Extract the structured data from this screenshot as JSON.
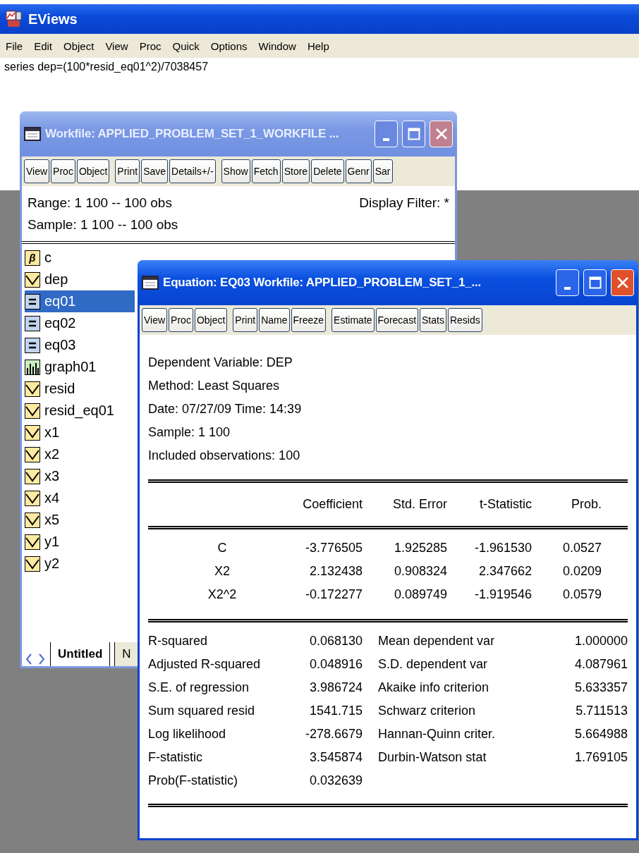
{
  "app": {
    "title": "EViews",
    "menu": [
      "File",
      "Edit",
      "Object",
      "View",
      "Proc",
      "Quick",
      "Options",
      "Window",
      "Help"
    ],
    "command": "series dep=(100*resid_eq01^2)/7038457"
  },
  "workfile": {
    "title": "Workfile: APPLIED_PROBLEM_SET_1_WORKFILE ...",
    "active": false,
    "toolbar": [
      [
        "View",
        "Proc",
        "Object"
      ],
      [
        "Print",
        "Save",
        "Details+/-"
      ],
      [
        "Show",
        "Fetch",
        "Store",
        "Delete",
        "Genr",
        "Sar"
      ]
    ],
    "range": "Range:  1 100  --  100 obs",
    "sample": "Sample: 1 100  --  100 obs",
    "filter": "Display Filter: *",
    "objects": [
      {
        "name": "c",
        "kind": "coef",
        "glyph": "β",
        "selected": false
      },
      {
        "name": "dep",
        "kind": "series",
        "selected": false
      },
      {
        "name": "eq01",
        "kind": "equation",
        "selected": true
      },
      {
        "name": "eq02",
        "kind": "equation",
        "selected": false
      },
      {
        "name": "eq03",
        "kind": "equation",
        "selected": false
      },
      {
        "name": "graph01",
        "kind": "graph",
        "selected": false
      },
      {
        "name": "resid",
        "kind": "series",
        "selected": false
      },
      {
        "name": "resid_eq01",
        "kind": "series",
        "selected": false
      },
      {
        "name": "x1",
        "kind": "series",
        "selected": false
      },
      {
        "name": "x2",
        "kind": "series",
        "selected": false
      },
      {
        "name": "x3",
        "kind": "series",
        "selected": false
      },
      {
        "name": "x4",
        "kind": "series",
        "selected": false
      },
      {
        "name": "x5",
        "kind": "series",
        "selected": false
      },
      {
        "name": "y1",
        "kind": "series",
        "selected": false
      },
      {
        "name": "y2",
        "kind": "series",
        "selected": false
      }
    ],
    "tabs": [
      {
        "label": "Untitled",
        "selected": true
      },
      {
        "label": "N",
        "selected": false
      }
    ]
  },
  "equation": {
    "title": "Equation: EQ03   Workfile: APPLIED_PROBLEM_SET_1_...",
    "active": true,
    "toolbar": [
      [
        "View",
        "Proc",
        "Object"
      ],
      [
        "Print",
        "Name",
        "Freeze"
      ],
      [
        "Estimate",
        "Forecast",
        "Stats",
        "Resids"
      ]
    ],
    "header": [
      "Dependent Variable: DEP",
      "Method: Least Squares",
      "Date: 07/27/09   Time: 14:39",
      "Sample: 1 100",
      "Included observations: 100"
    ],
    "columns": [
      "",
      "Coefficient",
      "Std. Error",
      "t-Statistic",
      "Prob."
    ],
    "rows": [
      [
        "C",
        "-3.776505",
        "1.925285",
        "-1.961530",
        "0.0527"
      ],
      [
        "X2",
        "2.132438",
        "0.908324",
        "2.347662",
        "0.0209"
      ],
      [
        "X2^2",
        "-0.172277",
        "0.089749",
        "-1.919546",
        "0.0579"
      ]
    ],
    "stats": [
      [
        "R-squared",
        "0.068130",
        "Mean dependent var",
        "1.000000"
      ],
      [
        "Adjusted R-squared",
        "0.048916",
        "S.D. dependent var",
        "4.087961"
      ],
      [
        "S.E. of regression",
        "3.986724",
        "Akaike info criterion",
        "5.633357"
      ],
      [
        "Sum squared resid",
        "1541.715",
        "Schwarz criterion",
        "5.711513"
      ],
      [
        "Log likelihood",
        "-278.6679",
        "Hannan-Quinn criter.",
        "5.664988"
      ],
      [
        "F-statistic",
        "3.545874",
        "Durbin-Watson stat",
        "1.769105"
      ],
      [
        "Prob(F-statistic)",
        "0.032639"
      ]
    ]
  }
}
